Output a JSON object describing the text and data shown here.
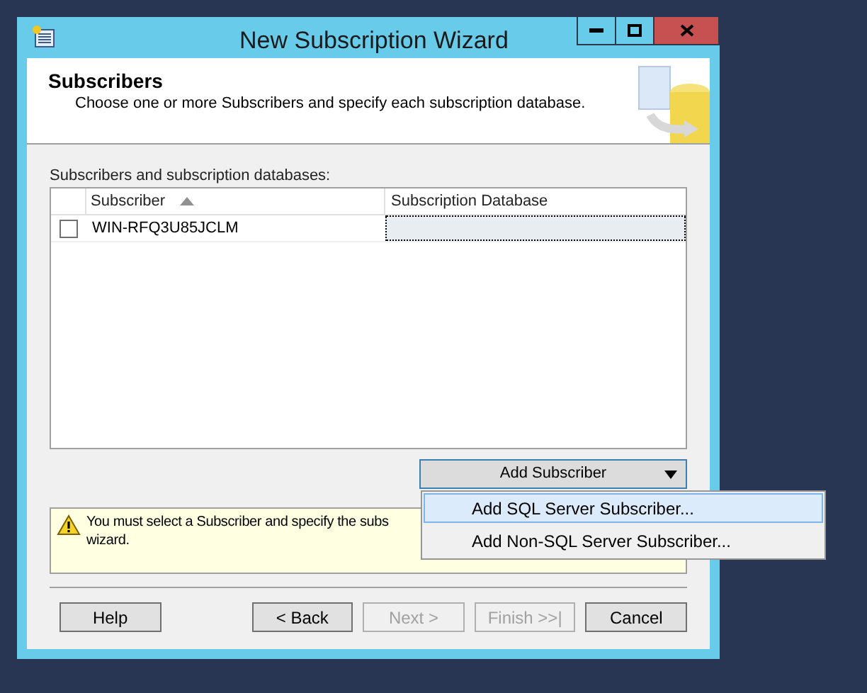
{
  "window": {
    "title": "New Subscription Wizard"
  },
  "header": {
    "title": "Subscribers",
    "subtitle": "Choose one or more Subscribers and specify each subscription database."
  },
  "grid": {
    "label": "Subscribers and subscription databases:",
    "columns": [
      {
        "label": "Subscriber",
        "sorted": true
      },
      {
        "label": "Subscription Database",
        "sorted": false
      }
    ],
    "rows": [
      {
        "checked": false,
        "subscriber": "WIN-RFQ3U85JCLM",
        "database_focused": true
      }
    ]
  },
  "add_button": {
    "label": "Add Subscriber"
  },
  "menu": [
    {
      "label": "Add SQL Server Subscriber...",
      "selected": true
    },
    {
      "label": "Add Non-SQL Server Subscriber...",
      "selected": false
    }
  ],
  "warning": {
    "lines": [
      "You must select a Subscriber and specify the subs",
      "wizard."
    ]
  },
  "buttons": [
    {
      "label": "Help",
      "disabled": false
    },
    {
      "label": "< Back",
      "disabled": false
    },
    {
      "label": "Next >",
      "disabled": true
    },
    {
      "label": "Finish >>|",
      "disabled": true
    },
    {
      "label": "Cancel",
      "disabled": false
    }
  ]
}
